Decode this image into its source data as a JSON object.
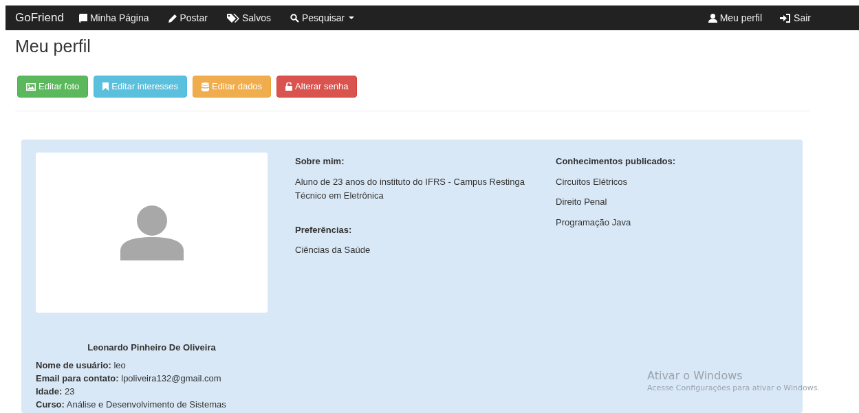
{
  "navbar": {
    "brand": "GoFriend",
    "left_items": [
      {
        "label": "Minha Página",
        "dropdown": false
      },
      {
        "label": "Postar",
        "dropdown": false
      },
      {
        "label": "Salvos",
        "dropdown": false
      },
      {
        "label": "Pesquisar",
        "dropdown": true
      }
    ],
    "right_items": [
      {
        "label": "Meu perfil"
      },
      {
        "label": "Sair"
      }
    ]
  },
  "page_title": "Meu perfil",
  "actions": [
    {
      "label": "Editar foto"
    },
    {
      "label": "Editar interesses"
    },
    {
      "label": "Editar dados"
    },
    {
      "label": "Alterar senha"
    }
  ],
  "profile": {
    "name": "Leonardo Pinheiro De Oliveira",
    "fields": [
      {
        "label": "Nome de usuário:",
        "value": "leo"
      },
      {
        "label": "Email para contato:",
        "value": "lpoliveira132@gmail.com"
      },
      {
        "label": "Idade:",
        "value": "23"
      },
      {
        "label": "Curso:",
        "value": "Análise e Desenvolvimento de Sistemas"
      }
    ],
    "about_heading": "Sobre mim:",
    "about": "Aluno de 23 anos do instituto do IFRS - Campus Restinga Técnico em Eletrônica",
    "preferences_heading": "Preferências:",
    "preferences": [
      "Ciências da Saúde"
    ],
    "knowledge_heading": "Conhecimentos publicados:",
    "knowledge": [
      "Circuitos Elétricos",
      "Direito Penal",
      "Programação Java"
    ]
  },
  "os_overlay": {
    "title": "Ativar o Windows",
    "subtitle": "Acesse Configurações para ativar o Windows."
  }
}
